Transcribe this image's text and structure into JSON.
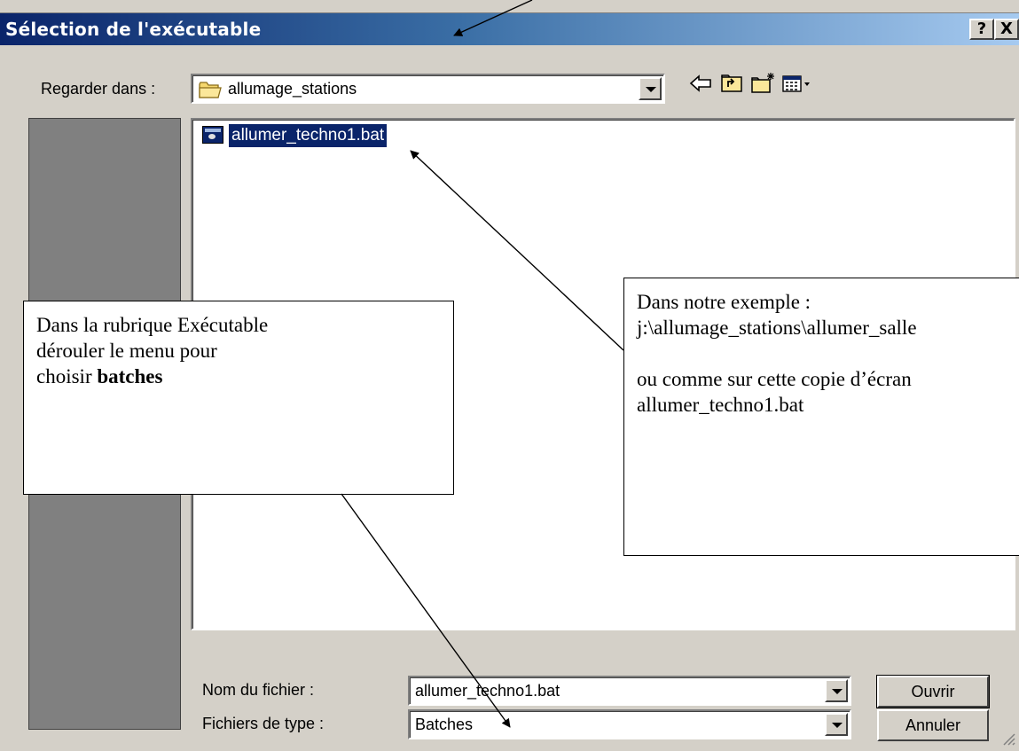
{
  "dialog": {
    "title": "Sélection de l'exécutable",
    "help_button": "?",
    "close_button": "X"
  },
  "look_in": {
    "label": "Regarder dans :",
    "value": "allumage_stations"
  },
  "toolbar_icons": [
    "back-icon",
    "up-folder-icon",
    "new-folder-icon",
    "view-menu-icon"
  ],
  "files": [
    {
      "name": "allumer_techno1.bat",
      "icon": "batch-file-icon",
      "selected": true
    }
  ],
  "filename": {
    "label": "Nom du fichier :",
    "value": "allumer_techno1.bat"
  },
  "filetype": {
    "label": "Fichiers de type :",
    "value": "Batches"
  },
  "buttons": {
    "open": "Ouvrir",
    "cancel": "Annuler"
  },
  "annotations": {
    "left": {
      "line1": "Dans la rubrique Exécutable",
      "line2": "dérouler le menu pour",
      "line3_prefix": "choisir ",
      "line3_bold": "batches"
    },
    "right": {
      "line1": "Dans notre exemple :",
      "line2": "j:\\allumage_stations\\allumer_salle",
      "line3": "ou comme sur cette copie d’écran",
      "line4": "allumer_techno1.bat"
    }
  }
}
